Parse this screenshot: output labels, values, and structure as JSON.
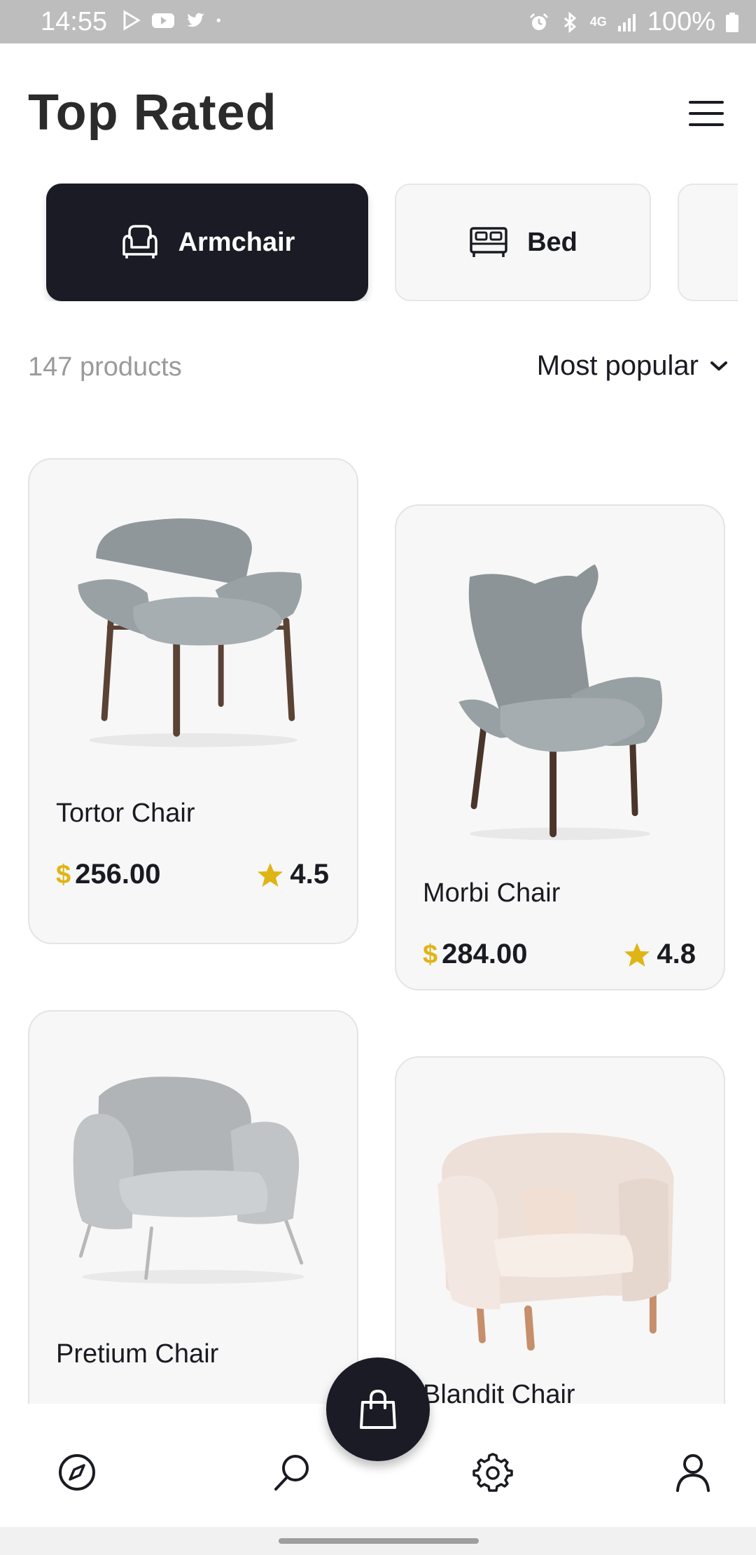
{
  "status_bar": {
    "time": "14:55",
    "battery": "100%",
    "network": "4G",
    "left_icons": [
      "play-store-icon",
      "youtube-icon",
      "twitter-icon",
      "dot-icon"
    ],
    "right_icons": [
      "alarm-icon",
      "bluetooth-icon",
      "4g-icon",
      "signal-icon",
      "battery-icon"
    ]
  },
  "header": {
    "title": "Top Rated",
    "menu_icon": "hamburger-menu-icon"
  },
  "categories": [
    {
      "label": "Armchair",
      "icon": "armchair-icon",
      "active": true
    },
    {
      "label": "Bed",
      "icon": "bed-icon",
      "active": false
    },
    {
      "label": "",
      "icon": "",
      "active": false
    }
  ],
  "listing": {
    "count_text": "147 products",
    "sort_label": "Most popular",
    "sort_icon": "chevron-down-icon"
  },
  "products": [
    {
      "name": "Tortor Chair",
      "currency": "$",
      "price": "256.00",
      "rating": "4.5",
      "image": "grey-leather-armchair-wood-legs"
    },
    {
      "name": "Morbi Chair",
      "currency": "$",
      "price": "284.00",
      "rating": "4.8",
      "image": "grey-wingback-chair-wood-legs"
    },
    {
      "name": "Pretium Chair",
      "currency": "$",
      "price": "",
      "rating": "",
      "image": "light-grey-leather-armchair-metal-legs"
    },
    {
      "name": "Blandit Chair",
      "currency": "$",
      "price": "",
      "rating": "",
      "image": "cream-tub-chair-wood-legs"
    }
  ],
  "bottom_nav": {
    "items": [
      "compass-icon",
      "search-icon",
      "settings-icon",
      "profile-icon"
    ],
    "fab_icon": "shopping-bag-icon"
  },
  "colors": {
    "primary_dark": "#1a1b25",
    "accent_gold": "#e0b415",
    "card_bg": "#f7f7f7",
    "status_bar_bg": "#bdbdbd",
    "muted_text": "#9a9a9a"
  }
}
